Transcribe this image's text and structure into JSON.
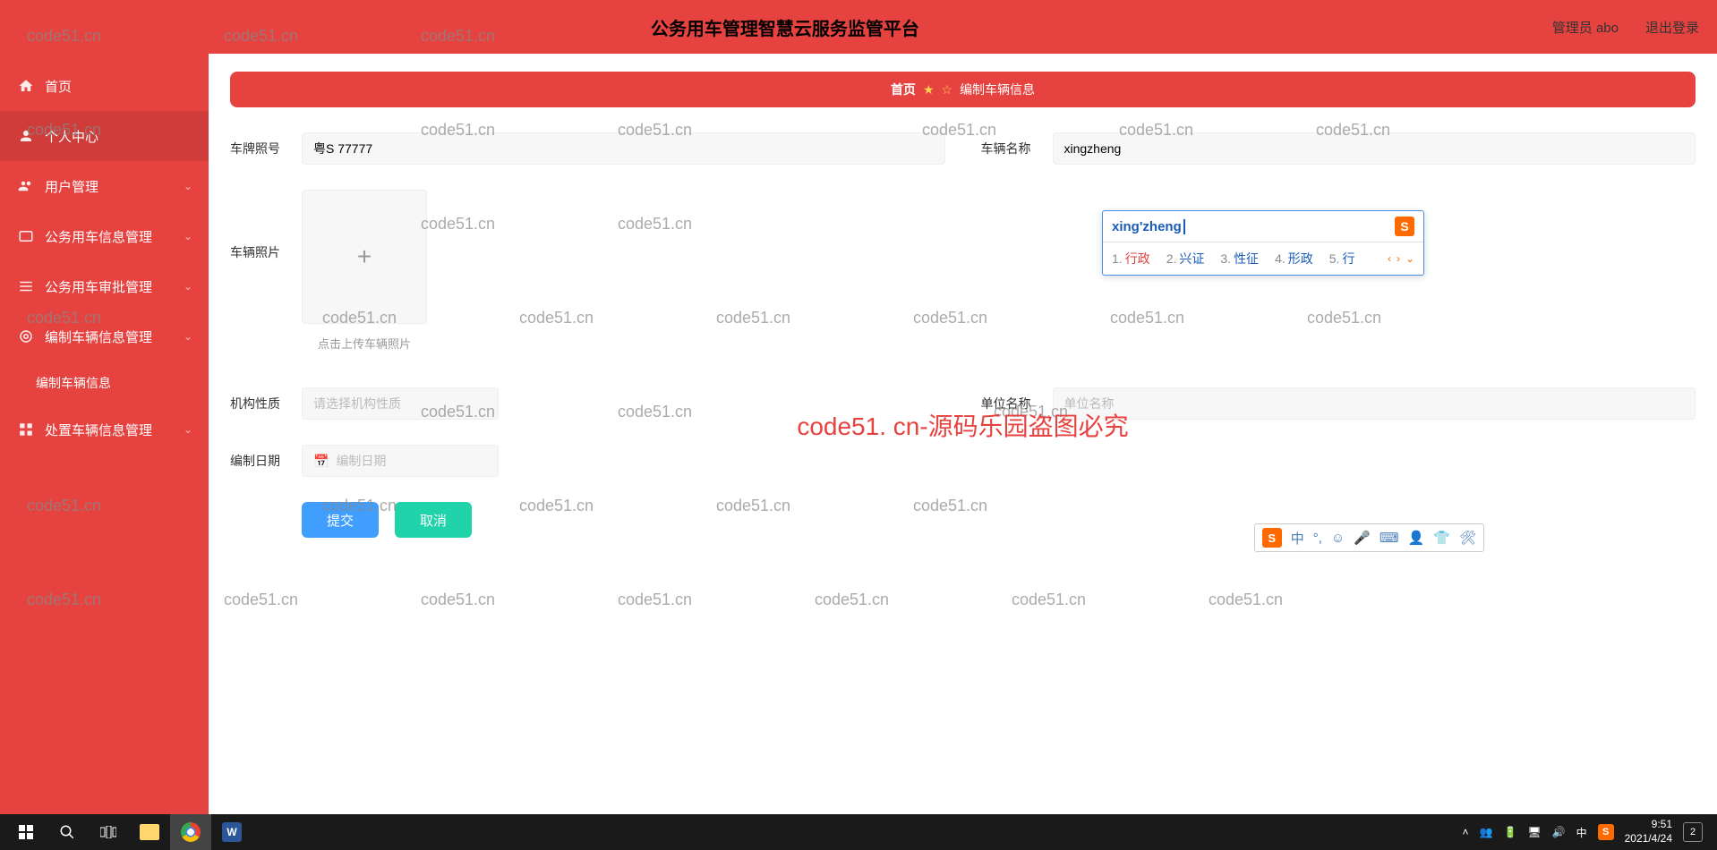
{
  "header": {
    "title": "公务用车管理智慧云服务监管平台",
    "user_label": "管理员 abo",
    "logout_label": "退出登录"
  },
  "sidebar": {
    "items": [
      {
        "label": "首页",
        "icon": "home"
      },
      {
        "label": "个人中心",
        "icon": "user"
      },
      {
        "label": "用户管理",
        "icon": "users",
        "expandable": true
      },
      {
        "label": "公务用车信息管理",
        "icon": "car",
        "expandable": true
      },
      {
        "label": "公务用车审批管理",
        "icon": "list",
        "expandable": true
      },
      {
        "label": "编制车辆信息管理",
        "icon": "target",
        "expandable": true
      },
      {
        "label": "处置车辆信息管理",
        "icon": "grid",
        "expandable": true
      }
    ],
    "subitem": "编制车辆信息"
  },
  "breadcrumb": {
    "home": "首页",
    "current": "编制车辆信息"
  },
  "form": {
    "plate_label": "车牌照号",
    "plate_value": "粤S 77777",
    "name_label": "车辆名称",
    "name_value": "xingzheng",
    "photo_label": "车辆照片",
    "photo_hint": "点击上传车辆照片",
    "orgtype_label": "机构性质",
    "orgtype_placeholder": "请选择机构性质",
    "unitname_label": "单位名称",
    "unitname_placeholder": "单位名称",
    "date_label": "编制日期",
    "date_placeholder": "编制日期",
    "submit": "提交",
    "cancel": "取消"
  },
  "ime": {
    "pinyin": "xing'zheng",
    "candidates": [
      {
        "n": "1.",
        "t": "行政"
      },
      {
        "n": "2.",
        "t": "兴证"
      },
      {
        "n": "3.",
        "t": "性征"
      },
      {
        "n": "4.",
        "t": "形政"
      },
      {
        "n": "5.",
        "t": "行"
      }
    ],
    "mode": "中"
  },
  "watermark_main": "code51. cn-源码乐园盗图必究",
  "watermark_small": "code51.cn",
  "taskbar": {
    "time": "9:51",
    "date": "2021/4/24",
    "lang": "中",
    "notif_count": "2"
  }
}
